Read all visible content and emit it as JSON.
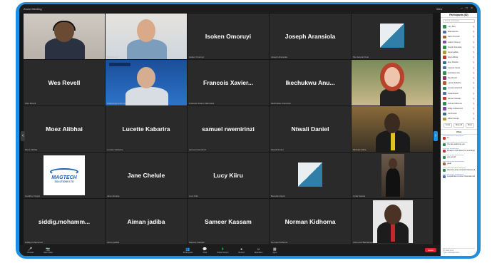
{
  "window": {
    "app_title": "Zoom Meeting",
    "view_label": "View"
  },
  "participants_panel": {
    "header": "Participants (82)",
    "search_placeholder": "Find a participant",
    "items": [
      {
        "name": "Lucy Kiiru",
        "color": "#2d8f4e"
      },
      {
        "name": "Talkmaximus",
        "color": "#4b6fb5"
      },
      {
        "name": "Kelvin Omondi",
        "color": "#b55a2d"
      },
      {
        "name": "Isoken Omoruyi",
        "color": "#7c4bb5"
      },
      {
        "name": "Joseph Aransiola",
        "color": "#2d8f4e"
      },
      {
        "name": "Aiman jadiba",
        "color": "#b5972d"
      },
      {
        "name": "Moez Alibhai",
        "color": "#c0392b"
      },
      {
        "name": "Jane Chelule",
        "color": "#2d6f8f"
      },
      {
        "name": "Francois Xavier",
        "color": "#4b6fb5"
      },
      {
        "name": "Ikechukwu Anu",
        "color": "#2d8f4e"
      },
      {
        "name": "Wes Revell",
        "color": "#8f2d6f"
      },
      {
        "name": "Lucette Kabarira",
        "color": "#b55a2d"
      },
      {
        "name": "samuel rwemirinzi",
        "color": "#2d8f4e"
      },
      {
        "name": "Ntwali Daniel",
        "color": "#4b6fb5"
      },
      {
        "name": "Sameer Kassam",
        "color": "#c0392b"
      },
      {
        "name": "Norman Kidhoma",
        "color": "#2d8f4e"
      },
      {
        "name": "siddig mohammed",
        "color": "#7c4bb5"
      },
      {
        "name": "Dan Kumar",
        "color": "#2d6f8f"
      },
      {
        "name": "Gillian Kaman",
        "color": "#b5972d"
      }
    ],
    "invite_label": "Invite",
    "mute_all_label": "Mute All",
    "more_label": "More"
  },
  "chat": {
    "header": "Chat",
    "messages": [
      {
        "from": "From Everyone to Everyone:",
        "text": "Hi",
        "color": "#c0392b"
      },
      {
        "from": "From Ikechukwu Anu to Everyone:",
        "text": "You are welcome you",
        "color": "#2d8f4e"
      },
      {
        "from": "From Me to Everyone:",
        "text": "Please is will share the recording?",
        "color": "#c0392b"
      },
      {
        "from": "From Lucy Kiiru to Everyone:",
        "text": "yes we will",
        "color": "#2d8f4e"
      },
      {
        "from": "From Lucy Kiiru to Everyone:",
        "text": "great",
        "color": "#b55a2d"
      },
      {
        "from": "From Moez Alibhai to Everyone:",
        "text": "How are your computer licenses against Microsoft ok?",
        "color": "#2d8f4e"
      },
      {
        "from": "From Lucy Kiiru to Everyone:",
        "text": "I would like to know if licenses today is adhered to both regulations between",
        "color": "#4b6fb5"
      }
    ],
    "to_label": "To: Everyone",
    "input_placeholder": "Type message here..."
  },
  "tiles": [
    {
      "id": "t1",
      "name": "",
      "caption": "Nitin Kumar",
      "type": "photo-man-headset"
    },
    {
      "id": "t2",
      "name": "",
      "caption": "Wes Revell",
      "type": "photo-grey-man"
    },
    {
      "id": "t3",
      "name": "Isoken Omoruyi",
      "caption": "Isoken Omoruyi",
      "type": "name"
    },
    {
      "id": "t4",
      "name": "Joseph Aransiola",
      "caption": "Joseph Aransiola",
      "type": "name"
    },
    {
      "id": "t5",
      "name": "",
      "caption": "Ms Hannah Kolo",
      "type": "logo-tri"
    },
    {
      "id": "t6",
      "name": "Wes Revell",
      "caption": "Wes Revell",
      "type": "name"
    },
    {
      "id": "t7",
      "name": "",
      "caption": "Nakipanga Anthony",
      "type": "photo-speaker"
    },
    {
      "id": "t8",
      "name": "Francois Xavier...",
      "caption": "Francois Xavier Habimana",
      "type": "name"
    },
    {
      "id": "t9",
      "name": "Ikechukwu Anu...",
      "caption": "Ikechukwu Anumudu",
      "type": "name"
    },
    {
      "id": "t10",
      "name": "",
      "caption": "Katherine Wenzel",
      "type": "photo-woman-red"
    },
    {
      "id": "t11",
      "name": "Moez Alibhai",
      "caption": "Moez Alibhai",
      "type": "name"
    },
    {
      "id": "t12",
      "name": "Lucette Kabarira",
      "caption": "Lucette Kabarira",
      "type": "name"
    },
    {
      "id": "t13",
      "name": "samuel rwemirinzi",
      "caption": "samuel rwemirinzi",
      "type": "name"
    },
    {
      "id": "t14",
      "name": "Ntwali Daniel",
      "caption": "Ntwali Daniel",
      "type": "name"
    },
    {
      "id": "t15",
      "name": "",
      "caption": "Michael Odhe",
      "type": "photo-man-suit"
    },
    {
      "id": "t16",
      "name": "",
      "caption": "Geoffrey Ongire",
      "type": "logo-magtech",
      "logo_line1": "MAGTECH",
      "logo_line2": "SOLUTIONS LTD"
    },
    {
      "id": "t17",
      "name": "Jane Chelule",
      "caption": "Jane Chelule",
      "type": "name"
    },
    {
      "id": "t18",
      "name": "Lucy Kiiru",
      "caption": "Lucy Kiiru",
      "type": "name"
    },
    {
      "id": "t19",
      "name": "",
      "caption": "Benedict Agoro",
      "type": "logo-tri"
    },
    {
      "id": "t20",
      "name": "",
      "caption": "Lydia Saukia",
      "type": "photo-woman-standing"
    },
    {
      "id": "t21",
      "name": "siddig.mohamm...",
      "caption": "siddig.mohammed",
      "type": "name"
    },
    {
      "id": "t22",
      "name": "Aiman jadiba",
      "caption": "Aiman jadiba",
      "type": "name"
    },
    {
      "id": "t23",
      "name": "Sameer Kassam",
      "caption": "Sameer Kassam",
      "type": "name"
    },
    {
      "id": "t24",
      "name": "Norman Kidhoma",
      "caption": "Norman Kidhoma",
      "type": "name"
    },
    {
      "id": "t25",
      "name": "",
      "caption": "Ahmed Al Bakhaheet",
      "type": "photo-man-redtie"
    }
  ],
  "toolbar": {
    "buttons": [
      {
        "label": "Participants",
        "icon": "participants-icon",
        "glyph": "👥"
      },
      {
        "label": "Chat",
        "icon": "chat-icon",
        "glyph": "💬"
      },
      {
        "label": "Share Screen",
        "icon": "share-screen-icon",
        "glyph": "⬆"
      },
      {
        "label": "Record",
        "icon": "record-icon",
        "glyph": "●"
      },
      {
        "label": "Reactions",
        "icon": "reactions-icon",
        "glyph": "☺"
      },
      {
        "label": "Apps",
        "icon": "apps-icon",
        "glyph": "▦"
      }
    ],
    "audio_label": "Unmute",
    "video_label": "Start Video",
    "leave_label": "Leave"
  },
  "colors": {
    "accent": "#1f8fe0",
    "active_speaker": "#f2c230",
    "leave": "#e0242e"
  }
}
